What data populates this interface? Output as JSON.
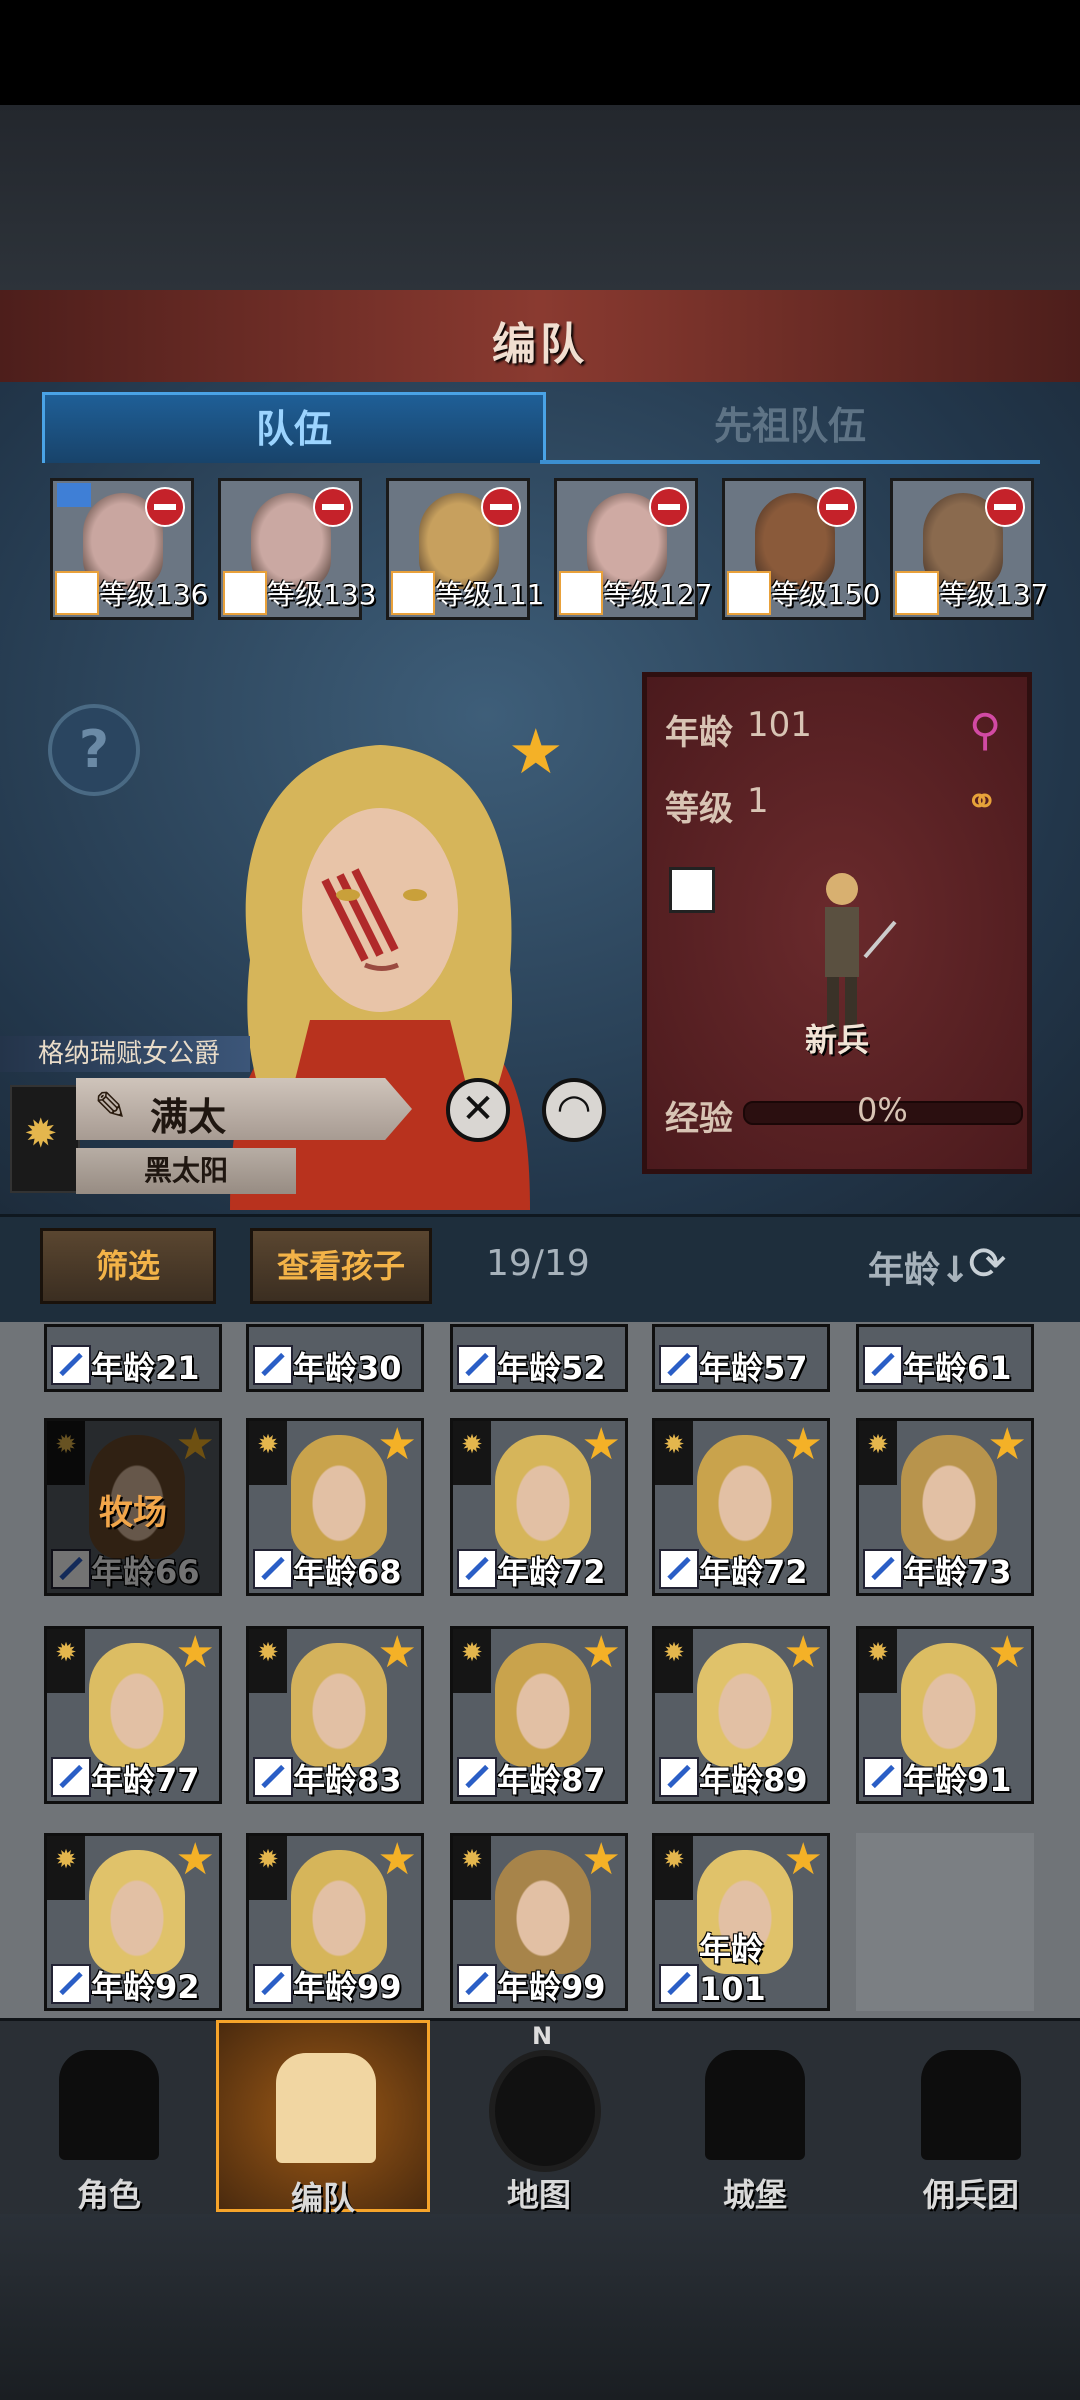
{
  "header": {
    "title": "编队"
  },
  "tabs": [
    {
      "label": "队伍",
      "active": true
    },
    {
      "label": "先祖队伍",
      "active": false
    }
  ],
  "team_members": [
    {
      "level_label": "等级136",
      "weapon_icon": "staff-icon",
      "portrait_color": "#c9a6a0",
      "has_flag": true
    },
    {
      "level_label": "等级133",
      "weapon_icon": "staff-icon",
      "portrait_color": "#caa8a2",
      "has_flag": false
    },
    {
      "level_label": "等级111",
      "weapon_icon": "bow-icon",
      "portrait_color": "#c7a05e",
      "has_flag": false
    },
    {
      "level_label": "等级127",
      "weapon_icon": "staff-icon",
      "portrait_color": "#cfaaa3",
      "has_flag": false
    },
    {
      "level_label": "等级150",
      "weapon_icon": "sword-icon",
      "portrait_color": "#8a5a3a",
      "has_flag": false
    },
    {
      "level_label": "等级137",
      "weapon_icon": "beast-icon",
      "portrait_color": "#8a6a4e",
      "has_flag": false
    }
  ],
  "hero": {
    "title": "格纳瑞赋女公爵",
    "name": "满太",
    "house": "黑太阳",
    "age_label": "年龄",
    "age_value": "101",
    "level_label": "等级",
    "level_value": "1",
    "unit_class": "新兵",
    "exp_label": "经验",
    "exp_value": "0%",
    "colors": {
      "hair": "#d6b55a",
      "card_bg": "#5a2224"
    }
  },
  "toolbar": {
    "filter_label": "筛选",
    "children_label": "查看孩子",
    "count": "19/19",
    "sort_label": "年龄↓"
  },
  "roster_partial": [
    "年龄21",
    "年龄30",
    "年龄52",
    "年龄57",
    "年龄61"
  ],
  "roster": [
    {
      "age": "年龄66",
      "dimmed": true,
      "dim_label": "牧场",
      "hair": "#6b4a2a"
    },
    {
      "age": "年龄68",
      "dimmed": false,
      "hair": "#c9a34c"
    },
    {
      "age": "年龄72",
      "dimmed": false,
      "hair": "#d6b55a"
    },
    {
      "age": "年龄72",
      "dimmed": false,
      "hair": "#c9a34c"
    },
    {
      "age": "年龄73",
      "dimmed": false,
      "hair": "#b8944c"
    },
    {
      "age": "年龄77",
      "dimmed": false,
      "hair": "#dcbd63"
    },
    {
      "age": "年龄83",
      "dimmed": false,
      "hair": "#d4b25c"
    },
    {
      "age": "年龄87",
      "dimmed": false,
      "hair": "#c9a34c"
    },
    {
      "age": "年龄89",
      "dimmed": false,
      "hair": "#e0c26a"
    },
    {
      "age": "年龄91",
      "dimmed": false,
      "hair": "#dcbd63"
    },
    {
      "age": "年龄92",
      "dimmed": false,
      "hair": "#e0c26a"
    },
    {
      "age": "年龄99",
      "dimmed": false,
      "hair": "#d6b55a"
    },
    {
      "age": "年龄99",
      "dimmed": false,
      "hair": "#a7844a"
    },
    {
      "age": "年龄101",
      "dimmed": false,
      "hair": "#e0c26a"
    }
  ],
  "nav": [
    {
      "label": "角色",
      "icon": "knight-icon",
      "active": false
    },
    {
      "label": "编队",
      "icon": "helmet-icon",
      "active": true
    },
    {
      "label": "地图",
      "icon": "compass-map-icon",
      "active": false,
      "compass_letter": "N"
    },
    {
      "label": "城堡",
      "icon": "castle-icon",
      "active": false
    },
    {
      "label": "佣兵团",
      "icon": "mercenary-icon",
      "active": false
    }
  ]
}
